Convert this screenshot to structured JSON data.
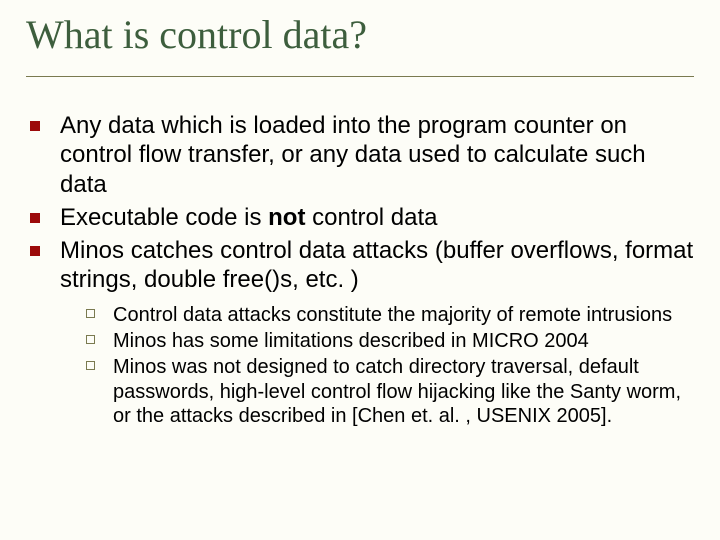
{
  "title": "What is control data?",
  "bullets": [
    {
      "text": "Any data which is loaded into the program counter on control flow transfer, or any data used to calculate such data"
    },
    {
      "text": "Executable code is <b>not</b> control data"
    },
    {
      "text": "Minos catches control data attacks (buffer overflows, format strings, double free()s, etc. )"
    }
  ],
  "subbullets": [
    {
      "text": "Control data attacks constitute the majority of remote intrusions"
    },
    {
      "text": "Minos has some limitations described in MICRO 2004"
    },
    {
      "text": "Minos was not designed to catch directory traversal, default passwords, high-level control flow hijacking like the Santy worm, or the attacks described in [Chen et. al. , USENIX 2005]."
    }
  ]
}
